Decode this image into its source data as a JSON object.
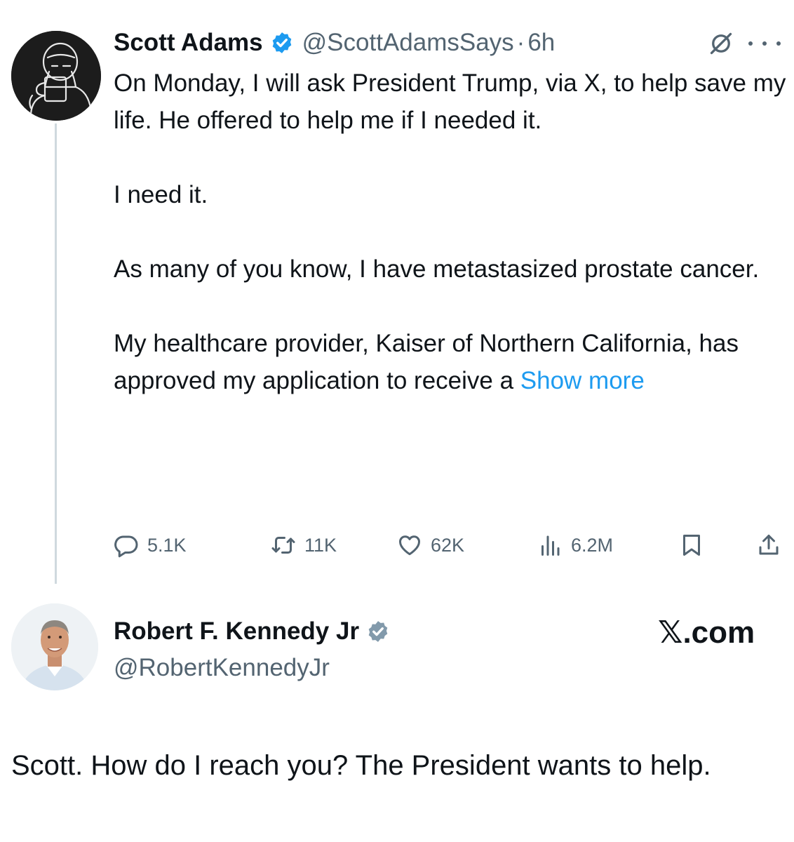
{
  "tweet1": {
    "author_name": "Scott Adams",
    "author_handle": "@ScottAdamsSays",
    "separator": "·",
    "time": "6h",
    "paragraphs": [
      "On Monday, I will ask President Trump, via X, to help save my life. He offered to help me if I needed it.",
      "I need it.",
      "As many of you know, I have metastasized prostate cancer.",
      "My healthcare provider, Kaiser of Northern California, has approved my application to receive a "
    ],
    "show_more": "Show more",
    "stats": {
      "replies": "5.1K",
      "retweets": "11K",
      "likes": "62K",
      "views": "6.2M"
    },
    "icons": [
      "verified-badge-icon",
      "grok-icon",
      "more-icon",
      "reply-icon",
      "retweet-icon",
      "like-icon",
      "views-icon",
      "bookmark-icon",
      "share-icon"
    ]
  },
  "tweet2": {
    "author_name": "Robert F. Kennedy Jr",
    "author_handle": "@RobertKennedyJr",
    "watermark": "𝕏.com",
    "reply_text": "Scott. How do I reach you? The President wants to help."
  },
  "colors": {
    "text": "#0f1419",
    "secondary": "#536471",
    "accent": "#1d9bf0",
    "thread_line": "#cfd9de"
  }
}
